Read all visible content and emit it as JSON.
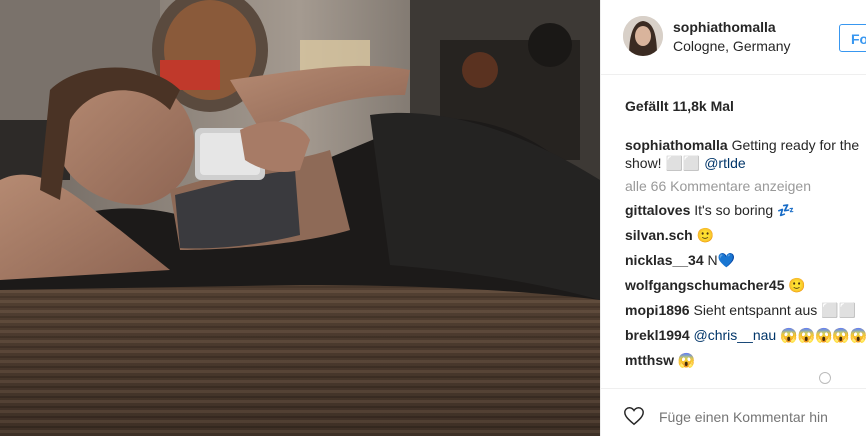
{
  "post": {
    "username": "sophiathomalla",
    "location": "Cologne, Germany",
    "follow_label": "Fo",
    "likes": "Gefällt 11,8k Mal",
    "caption": {
      "user": "sophiathomalla",
      "text": "Getting ready for the show! ⬜⬜",
      "mention": "@rtlde"
    },
    "view_all": "alle 66 Kommentare anzeigen",
    "comments": [
      {
        "user": "gittaloves",
        "text": "It's so boring 💤",
        "mention": ""
      },
      {
        "user": "silvan.sch",
        "text": "🙂",
        "mention": ""
      },
      {
        "user": "nicklas__34",
        "text": "N💙",
        "mention": ""
      },
      {
        "user": "wolfgangschumacher45",
        "text": "🙂",
        "mention": ""
      },
      {
        "user": "mopi1896",
        "text": "Sieht entspannt aus ⬜⬜",
        "mention": ""
      },
      {
        "user": "brekl1994",
        "text": "😱😱😱😱😱",
        "mention": "@chris__nau"
      },
      {
        "user": "mtthsw",
        "text": "😱",
        "mention": ""
      }
    ],
    "add_comment_placeholder": "Füge einen Kommentar hin"
  },
  "icons": [
    "heart-icon",
    "avatar"
  ],
  "colors": {
    "link": "#003569",
    "follow": "#3897f0",
    "muted": "#999999"
  }
}
